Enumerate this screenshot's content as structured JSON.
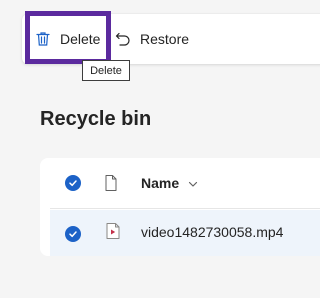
{
  "toolbar": {
    "delete_label": "Delete",
    "restore_label": "Restore",
    "tooltip": "Delete"
  },
  "page": {
    "title": "Recycle bin"
  },
  "list": {
    "column_name": "Name",
    "items": [
      {
        "name": "video1482730058.mp4",
        "type_icon": "video-file-icon",
        "selected": true
      }
    ]
  },
  "colors": {
    "accent": "#1c62c7",
    "focus_ring": "#5b2a9e",
    "video_icon": "#c4314b",
    "selected_row": "#eef4fb"
  },
  "icons": [
    "trash-icon",
    "undo-icon",
    "file-icon",
    "chevron-down-icon",
    "checkmark-icon",
    "video-file-icon"
  ]
}
